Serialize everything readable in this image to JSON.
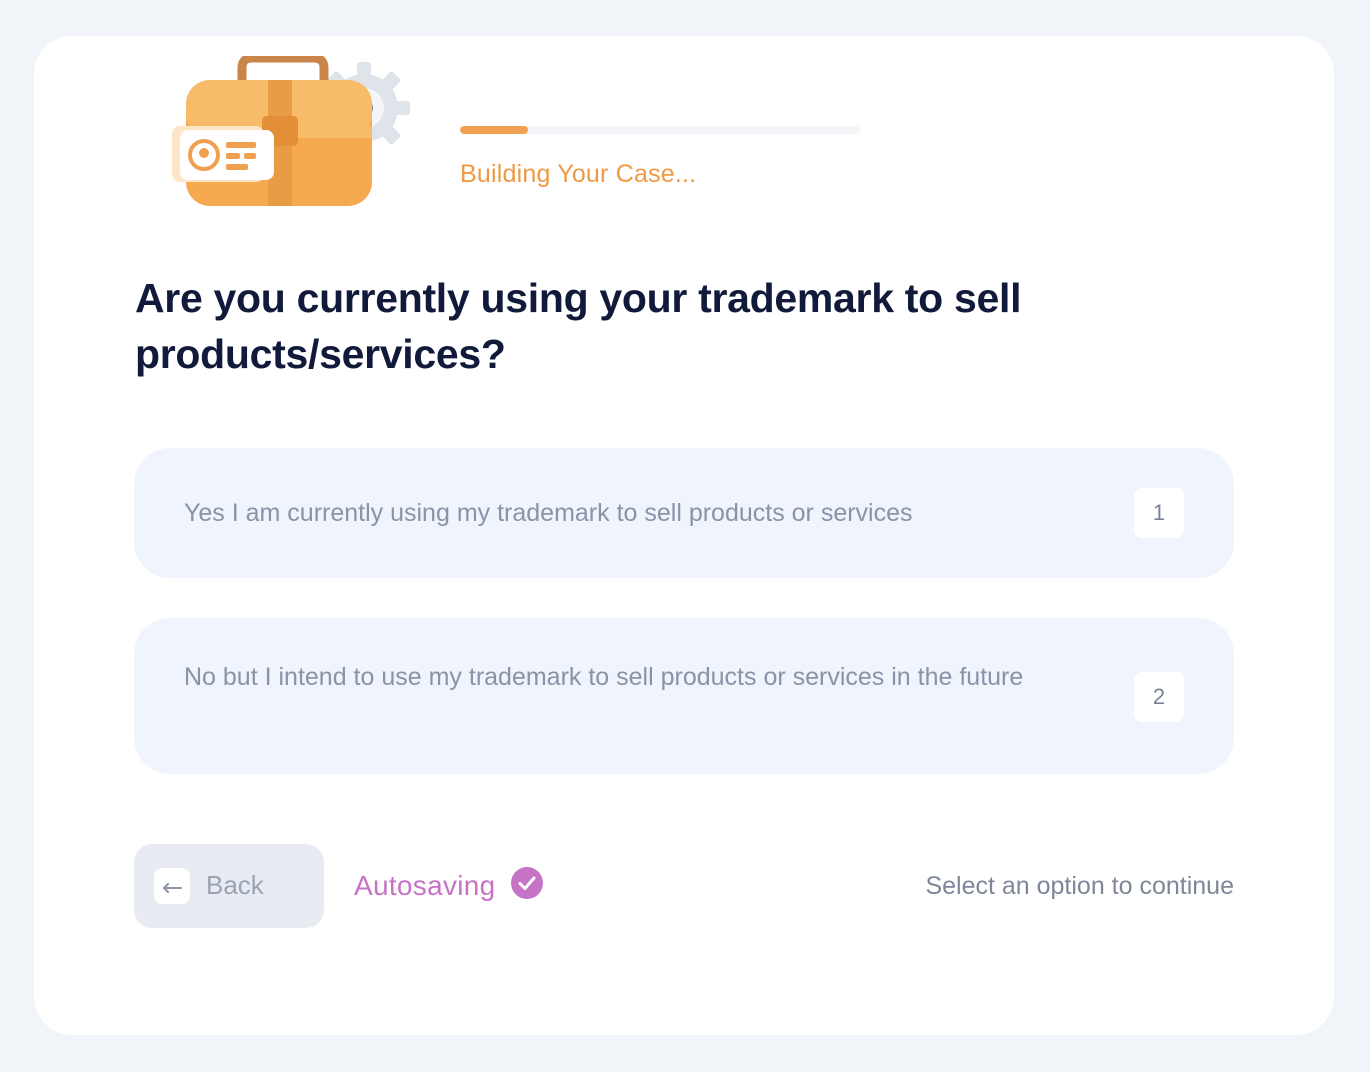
{
  "header": {
    "status": "Building Your Case...",
    "progress": 0.17,
    "illustration_icon": "briefcase-with-id-card-and-gear-icon"
  },
  "question": {
    "text": "Are you currently using your trademark to sell products/services?"
  },
  "options": [
    {
      "label": "Yes I am currently using my trademark to sell products or services",
      "key": "1"
    },
    {
      "label": "No but I intend to use my trademark to sell products or services in the future",
      "key": "2"
    }
  ],
  "footer": {
    "back_label": "Back",
    "back_icon": "back-arrow-icon",
    "autosave_label": "Autosaving",
    "autosave_icon": "check-circle-icon",
    "hint": "Select an option to continue"
  },
  "colors": {
    "accent_orange": "#f0a050",
    "autosave_purple": "#c673c6",
    "question_navy": "#111a3a",
    "option_bg": "#eff4fd"
  }
}
